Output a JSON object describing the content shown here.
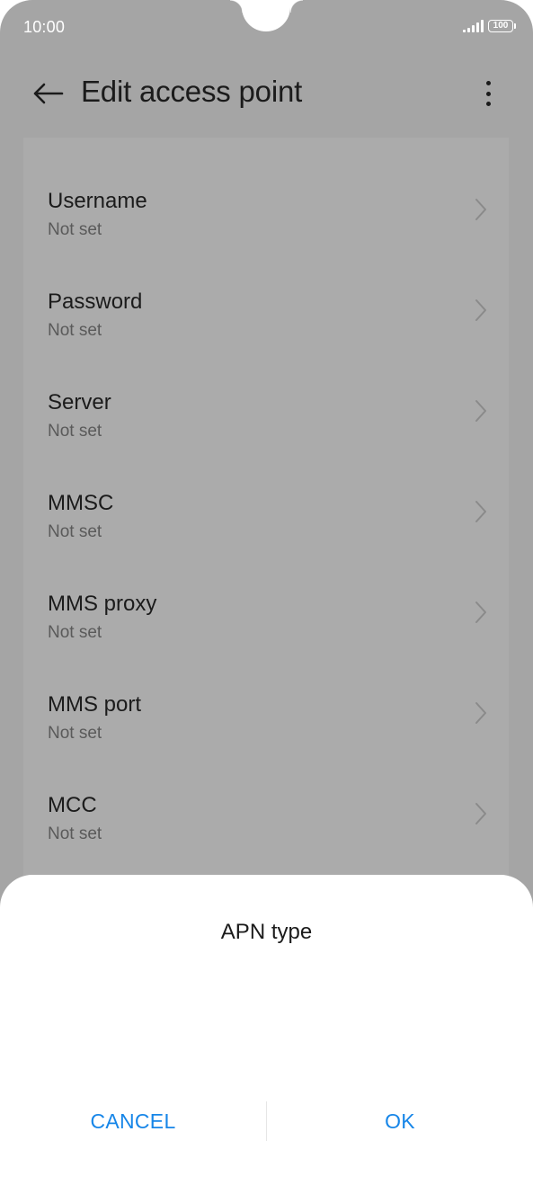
{
  "status_bar": {
    "time": "10:00",
    "battery": "100",
    "signal_icon": "signal-bars-icon",
    "battery_icon": "battery-icon"
  },
  "toolbar": {
    "title": "Edit access point",
    "back_icon": "arrow-left-icon",
    "more_icon": "more-vertical-icon"
  },
  "settings": {
    "rows": [
      {
        "title": "Username",
        "value": "Not set"
      },
      {
        "title": "Password",
        "value": "Not set"
      },
      {
        "title": "Server",
        "value": "Not set"
      },
      {
        "title": "MMSC",
        "value": "Not set"
      },
      {
        "title": "MMS proxy",
        "value": "Not set"
      },
      {
        "title": "MMS port",
        "value": "Not set"
      },
      {
        "title": "MCC",
        "value": "Not set"
      }
    ]
  },
  "dialog": {
    "title": "APN type",
    "cancel_label": "CANCEL",
    "ok_label": "OK"
  },
  "colors": {
    "scrim": "#a5a5a5",
    "card": "#ababab",
    "accent": "#1786e8"
  }
}
